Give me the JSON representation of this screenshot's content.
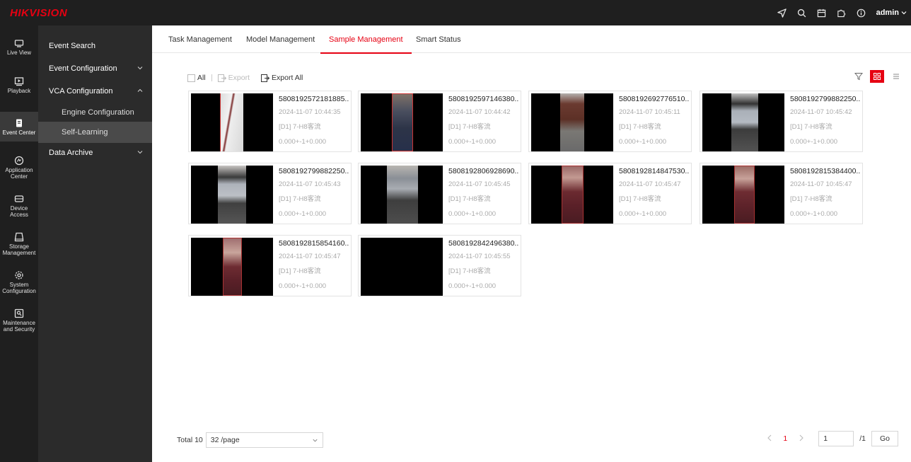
{
  "topbar": {
    "logo": "HIKVISION",
    "user": "admin",
    "icons": [
      "send-icon",
      "search-icon",
      "calendar-icon",
      "puzzle-icon",
      "info-icon"
    ]
  },
  "rail": [
    {
      "label_lines": [
        "Live View"
      ],
      "icon": "monitor-icon"
    },
    {
      "label_lines": [
        "Playback"
      ],
      "icon": "playback-icon"
    },
    {
      "label_lines": [
        "Event Center"
      ],
      "icon": "event-center-icon",
      "active": true
    },
    {
      "label_lines": [
        "Application",
        "Center"
      ],
      "icon": "application-icon"
    },
    {
      "label_lines": [
        "Device",
        "Access"
      ],
      "icon": "device-icon"
    },
    {
      "label_lines": [
        "Storage",
        "Management"
      ],
      "icon": "storage-icon"
    },
    {
      "label_lines": [
        "System",
        "Configuration"
      ],
      "icon": "gear-icon"
    },
    {
      "label_lines": [
        "Maintenance",
        "and Security"
      ],
      "icon": "maintenance-icon"
    }
  ],
  "submenu": {
    "event_search": "Event Search",
    "event_configuration": "Event Configuration",
    "vca_configuration": "VCA Configuration",
    "engine_configuration": "Engine Configuration",
    "self_learning": "Self-Learning",
    "data_archive": "Data Archive"
  },
  "tabs": [
    "Task Management",
    "Model Management",
    "Sample Management",
    "Smart Status"
  ],
  "active_tab": "Sample Management",
  "toolbar": {
    "all": "All",
    "export": "Export",
    "export_all": "Export All"
  },
  "samples": [
    {
      "id": "5808192572181885...",
      "time": "2024-11-07 10:44:35",
      "channel": "[D1] 7-H8客流",
      "value": "0.000+-1+0.000"
    },
    {
      "id": "5808192597146380...",
      "time": "2024-11-07 10:44:42",
      "channel": "[D1] 7-H8客流",
      "value": "0.000+-1+0.000"
    },
    {
      "id": "5808192692776510...",
      "time": "2024-11-07 10:45:11",
      "channel": "[D1] 7-H8客流",
      "value": "0.000+-1+0.000"
    },
    {
      "id": "5808192799882250...",
      "time": "2024-11-07 10:45:42",
      "channel": "[D1] 7-H8客流",
      "value": "0.000+-1+0.000"
    },
    {
      "id": "5808192799882250...",
      "time": "2024-11-07 10:45:43",
      "channel": "[D1] 7-H8客流",
      "value": "0.000+-1+0.000"
    },
    {
      "id": "5808192806928690...",
      "time": "2024-11-07 10:45:45",
      "channel": "[D1] 7-H8客流",
      "value": "0.000+-1+0.000"
    },
    {
      "id": "5808192814847530...",
      "time": "2024-11-07 10:45:47",
      "channel": "[D1] 7-H8客流",
      "value": "0.000+-1+0.000"
    },
    {
      "id": "5808192815384400...",
      "time": "2024-11-07 10:45:47",
      "channel": "[D1] 7-H8客流",
      "value": "0.000+-1+0.000"
    },
    {
      "id": "5808192815854160...",
      "time": "2024-11-07 10:45:47",
      "channel": "[D1] 7-H8客流",
      "value": "0.000+-1+0.000"
    },
    {
      "id": "5808192842496380...",
      "time": "2024-11-07 10:45:55",
      "channel": "[D1] 7-H8客流",
      "value": "0.000+-1+0.000"
    }
  ],
  "footer": {
    "total": "Total 10",
    "page_size": "32 /page",
    "current_page": "1",
    "goto_value": "1",
    "total_pages": "/1",
    "go": "Go"
  },
  "colors": {
    "accent": "#e60012",
    "topbar": "#1f1f1f",
    "sidebar": "#2b2b2b"
  }
}
